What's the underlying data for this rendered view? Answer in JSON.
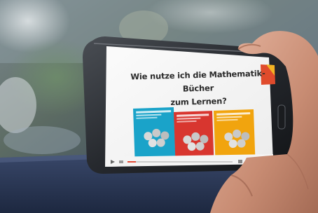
{
  "slide": {
    "title_line1": "Wie nutze ich die Mathematik-Bücher",
    "title_line2": "zum Lernen?"
  },
  "book_colors": [
    "#1aa3c9",
    "#d8362f",
    "#f1a40e"
  ],
  "icons": [
    "phone",
    "hand",
    "book-cover",
    "video-controls"
  ]
}
